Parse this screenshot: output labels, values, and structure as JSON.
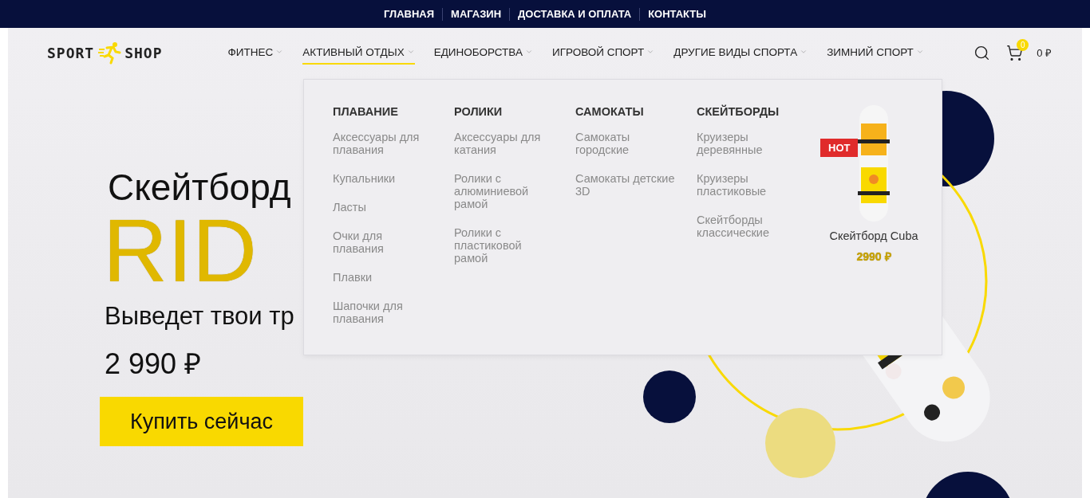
{
  "top_nav": [
    {
      "label": "ГЛАВНАЯ"
    },
    {
      "label": "МАГАЗИН"
    },
    {
      "label": "ДОСТАВКА И ОПЛАТА"
    },
    {
      "label": "КОНТАКТЫ"
    }
  ],
  "header": {
    "logo": {
      "left": "SPORT",
      "right": "SHOP"
    },
    "nav": [
      {
        "label": "ФИТНЕС",
        "selected": false
      },
      {
        "label": "АКТИВНЫЙ ОТДЫХ",
        "selected": true
      },
      {
        "label": "ЕДИНОБОРСТВА",
        "selected": false
      },
      {
        "label": "ИГРОВОЙ СПОРТ",
        "selected": false
      },
      {
        "label": "ДРУГИЕ ВИДЫ СПОРТА",
        "selected": false
      },
      {
        "label": "ЗИМНИЙ СПОРТ",
        "selected": false
      }
    ],
    "cart": {
      "count": "0",
      "total": "0 ₽"
    }
  },
  "mega_menu": {
    "columns": [
      {
        "title": "ПЛАВАНИЕ",
        "items": [
          "Аксессуары для плавания",
          "Купальники",
          "Ласты",
          "Очки для плавания",
          "Плавки",
          "Шапочки для плавания"
        ]
      },
      {
        "title": "РОЛИКИ",
        "items": [
          "Аксессуары для катания",
          "Ролики с алюминиевой рамой",
          "Ролики с пластиковой рамой"
        ]
      },
      {
        "title": "САМОКАТЫ",
        "items": [
          "Самокаты городские",
          "Самокаты детские 3D"
        ]
      },
      {
        "title": "СКЕЙТБОРДЫ",
        "items": [
          "Круизеры деревянные",
          "Круизеры пластиковые",
          "Скейтборды классические"
        ]
      }
    ],
    "product": {
      "badge": "HOT",
      "name": "Скейтборд Cuba",
      "price": "2990 ₽"
    }
  },
  "hero": {
    "title": "Скейтборд",
    "headline": "RID",
    "subtitle": "Выведет твои тр",
    "price": "2 990 ₽",
    "button": "Купить сейчас"
  }
}
